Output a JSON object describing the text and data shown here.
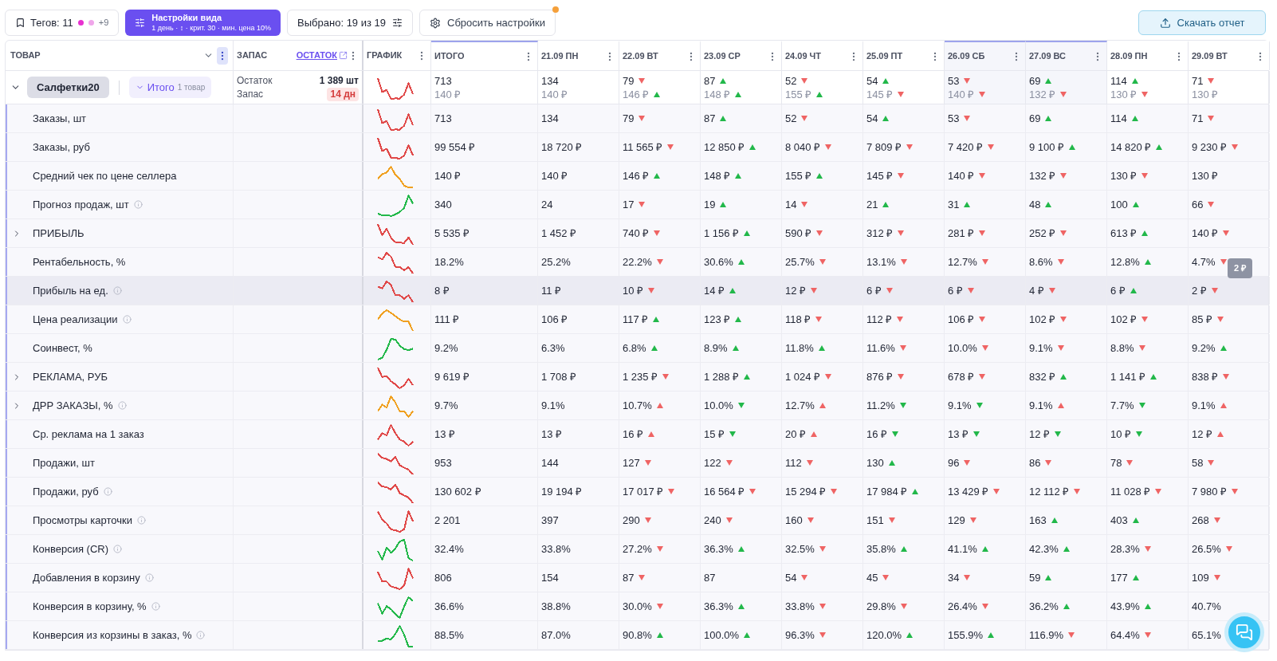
{
  "toolbar": {
    "tags": {
      "label": "Тегов: 11",
      "dots": [
        {
          "color": "#e830d0"
        },
        {
          "color": "#f0a6ea"
        }
      ],
      "more": "+9"
    },
    "view_settings": {
      "title": "Настройки вида",
      "subtitle": "1 день · ↕ · крит. 30 · мин. цена 10%"
    },
    "selected": "Выбрано: 19 из 19",
    "reset": {
      "label": "Сбросить настройки",
      "notification": true
    },
    "download": "Скачать отчет"
  },
  "header": {
    "product": "ТОВАР",
    "stock": "ЗАПАС",
    "stock_link": "ОСТАТОК",
    "chart": "ГРАФИК"
  },
  "columns": [
    {
      "label": "ИТОГО",
      "highlighted": true
    },
    {
      "label": "21.09 ПН",
      "highlighted": false
    },
    {
      "label": "22.09 ВТ",
      "highlighted": false
    },
    {
      "label": "23.09 СР",
      "highlighted": false
    },
    {
      "label": "24.09 ЧТ",
      "highlighted": false
    },
    {
      "label": "25.09 ПТ",
      "highlighted": false
    },
    {
      "label": "26.09 СБ",
      "highlighted": true
    },
    {
      "label": "27.09 ВС",
      "highlighted": true
    },
    {
      "label": "28.09 ПН",
      "highlighted": false
    },
    {
      "label": "29.09 ВТ",
      "highlighted": false
    }
  ],
  "product": {
    "name": "Салфетки20",
    "expanded": true,
    "total_label": "Итого",
    "total_count": "1 товар",
    "stock_label": "Остаток",
    "stock_value": "1 389 шт",
    "reserve_label": "Запас",
    "reserve_value": "14 дн",
    "color": "#e04848",
    "cells": [
      {
        "v": "713",
        "p": "140 ₽"
      },
      {
        "v": "134",
        "p": "140 ₽"
      },
      {
        "v": "79",
        "up": false,
        "p": "146 ₽",
        "p_up": true
      },
      {
        "v": "87",
        "up": true,
        "p": "148 ₽",
        "p_up": true
      },
      {
        "v": "52",
        "up": false,
        "p": "155 ₽",
        "p_up": true
      },
      {
        "v": "54",
        "up": true,
        "p": "145 ₽",
        "p_up": false
      },
      {
        "v": "53",
        "up": false,
        "p": "140 ₽",
        "p_up": false
      },
      {
        "v": "69",
        "up": true,
        "p": "132 ₽",
        "p_up": false
      },
      {
        "v": "114",
        "up": true,
        "p": "130 ₽",
        "p_up": false
      },
      {
        "v": "71",
        "up": false,
        "p": "130 ₽"
      }
    ]
  },
  "rows": [
    {
      "label": "Заказы, шт",
      "color": "#e04848",
      "cells": [
        {
          "v": "713"
        },
        {
          "v": "134"
        },
        {
          "v": "79",
          "up": false
        },
        {
          "v": "87",
          "up": true
        },
        {
          "v": "52",
          "up": false
        },
        {
          "v": "54",
          "up": true
        },
        {
          "v": "53",
          "up": false
        },
        {
          "v": "69",
          "up": true
        },
        {
          "v": "114",
          "up": true
        },
        {
          "v": "71",
          "up": false
        }
      ]
    },
    {
      "label": "Заказы, руб",
      "color": "#e04848",
      "cells": [
        {
          "v": "99 554 ₽"
        },
        {
          "v": "18 720 ₽"
        },
        {
          "v": "11 565 ₽",
          "up": false
        },
        {
          "v": "12 850 ₽",
          "up": true
        },
        {
          "v": "8 040 ₽",
          "up": false
        },
        {
          "v": "7 809 ₽",
          "up": false
        },
        {
          "v": "7 420 ₽",
          "up": false
        },
        {
          "v": "9 100 ₽",
          "up": true
        },
        {
          "v": "14 820 ₽",
          "up": true
        },
        {
          "v": "9 230 ₽",
          "up": false
        }
      ]
    },
    {
      "label": "Средний чек по цене селлера",
      "color": "#f0a020",
      "cells": [
        {
          "v": "140 ₽"
        },
        {
          "v": "140 ₽"
        },
        {
          "v": "146 ₽",
          "up": true
        },
        {
          "v": "148 ₽",
          "up": true
        },
        {
          "v": "155 ₽",
          "up": true
        },
        {
          "v": "145 ₽",
          "up": false
        },
        {
          "v": "140 ₽",
          "up": false
        },
        {
          "v": "132 ₽",
          "up": false
        },
        {
          "v": "130 ₽",
          "up": false
        },
        {
          "v": "130 ₽"
        }
      ]
    },
    {
      "label": "Прогноз продаж, шт",
      "info": true,
      "color": "#22b84a",
      "cells": [
        {
          "v": "340"
        },
        {
          "v": "24"
        },
        {
          "v": "17",
          "up": false
        },
        {
          "v": "19",
          "up": true
        },
        {
          "v": "14",
          "up": false
        },
        {
          "v": "21",
          "up": true
        },
        {
          "v": "31",
          "up": true
        },
        {
          "v": "48",
          "up": true
        },
        {
          "v": "100",
          "up": true
        },
        {
          "v": "66",
          "up": false
        }
      ]
    },
    {
      "label": "ПРИБЫЛЬ",
      "expandable": true,
      "color": "#e04848",
      "cells": [
        {
          "v": "5 535 ₽"
        },
        {
          "v": "1 452 ₽"
        },
        {
          "v": "740 ₽",
          "up": false
        },
        {
          "v": "1 156 ₽",
          "up": true
        },
        {
          "v": "590 ₽",
          "up": false
        },
        {
          "v": "312 ₽",
          "up": false
        },
        {
          "v": "281 ₽",
          "up": false
        },
        {
          "v": "252 ₽",
          "up": false
        },
        {
          "v": "613 ₽",
          "up": true
        },
        {
          "v": "140 ₽",
          "up": false
        }
      ]
    },
    {
      "label": "Рентабельность, %",
      "color": "#e04848",
      "cells": [
        {
          "v": "18.2%"
        },
        {
          "v": "25.2%"
        },
        {
          "v": "22.2%",
          "up": false
        },
        {
          "v": "30.6%",
          "up": true
        },
        {
          "v": "25.7%",
          "up": false
        },
        {
          "v": "13.1%",
          "up": false
        },
        {
          "v": "12.7%",
          "up": false
        },
        {
          "v": "8.6%",
          "up": false
        },
        {
          "v": "12.8%",
          "up": true
        },
        {
          "v": "4.7%",
          "up": false
        }
      ]
    },
    {
      "label": "Прибыль на ед.",
      "info": true,
      "hovered": true,
      "tooltip": "2 ₽",
      "color": "#e04848",
      "cells": [
        {
          "v": "8 ₽"
        },
        {
          "v": "11 ₽"
        },
        {
          "v": "10 ₽",
          "up": false
        },
        {
          "v": "14 ₽",
          "up": true
        },
        {
          "v": "12 ₽",
          "up": false
        },
        {
          "v": "6 ₽",
          "up": false
        },
        {
          "v": "6 ₽",
          "up": false
        },
        {
          "v": "4 ₽",
          "up": false
        },
        {
          "v": "6 ₽",
          "up": true
        },
        {
          "v": "2 ₽",
          "up": false
        }
      ]
    },
    {
      "label": "Цена реализации",
      "info": true,
      "color": "#f0a020",
      "cells": [
        {
          "v": "111 ₽"
        },
        {
          "v": "106 ₽"
        },
        {
          "v": "117 ₽",
          "up": true
        },
        {
          "v": "123 ₽",
          "up": true
        },
        {
          "v": "118 ₽",
          "up": false
        },
        {
          "v": "112 ₽",
          "up": false
        },
        {
          "v": "106 ₽",
          "up": false
        },
        {
          "v": "102 ₽",
          "up": false
        },
        {
          "v": "102 ₽",
          "up": false
        },
        {
          "v": "85 ₽",
          "up": false
        }
      ]
    },
    {
      "label": "Соинвест, %",
      "color": "#22b84a",
      "cells": [
        {
          "v": "9.2%"
        },
        {
          "v": "6.3%"
        },
        {
          "v": "6.8%",
          "up": true
        },
        {
          "v": "8.9%",
          "up": true
        },
        {
          "v": "11.8%",
          "up": true
        },
        {
          "v": "11.6%",
          "up": false
        },
        {
          "v": "10.0%",
          "up": false
        },
        {
          "v": "9.1%",
          "up": false
        },
        {
          "v": "8.8%",
          "up": false
        },
        {
          "v": "9.2%",
          "up": true
        }
      ]
    },
    {
      "label": "РЕКЛАМА, РУБ",
      "expandable": true,
      "color": "#e04848",
      "cells": [
        {
          "v": "9 619 ₽"
        },
        {
          "v": "1 708 ₽"
        },
        {
          "v": "1 235 ₽",
          "up": false
        },
        {
          "v": "1 288 ₽",
          "up": true
        },
        {
          "v": "1 024 ₽",
          "up": false
        },
        {
          "v": "876 ₽",
          "up": false
        },
        {
          "v": "678 ₽",
          "up": false
        },
        {
          "v": "832 ₽",
          "up": true
        },
        {
          "v": "1 141 ₽",
          "up": true
        },
        {
          "v": "838 ₽",
          "up": false
        }
      ]
    },
    {
      "label": "ДРР ЗАКАЗЫ, %",
      "expandable": true,
      "info": true,
      "inverse": true,
      "color": "#f0a020",
      "cells": [
        {
          "v": "9.7%"
        },
        {
          "v": "9.1%"
        },
        {
          "v": "10.7%",
          "up": true
        },
        {
          "v": "10.0%",
          "up": false
        },
        {
          "v": "12.7%",
          "up": true
        },
        {
          "v": "11.2%",
          "up": false
        },
        {
          "v": "9.1%",
          "up": false
        },
        {
          "v": "9.1%",
          "up": true
        },
        {
          "v": "7.7%",
          "up": false
        },
        {
          "v": "9.1%",
          "up": true
        }
      ]
    },
    {
      "label": "Ср. реклама на 1 заказ",
      "inverse": true,
      "color": "#e04848",
      "cells": [
        {
          "v": "13 ₽"
        },
        {
          "v": "13 ₽"
        },
        {
          "v": "16 ₽",
          "up": true
        },
        {
          "v": "15 ₽",
          "up": false
        },
        {
          "v": "20 ₽",
          "up": true
        },
        {
          "v": "16 ₽",
          "up": false
        },
        {
          "v": "13 ₽",
          "up": false
        },
        {
          "v": "12 ₽",
          "up": false
        },
        {
          "v": "10 ₽",
          "up": false
        },
        {
          "v": "12 ₽",
          "up": true
        }
      ]
    },
    {
      "label": "Продажи, шт",
      "color": "#e04848",
      "cells": [
        {
          "v": "953"
        },
        {
          "v": "144"
        },
        {
          "v": "127",
          "up": false
        },
        {
          "v": "122",
          "up": false
        },
        {
          "v": "112",
          "up": false
        },
        {
          "v": "130",
          "up": true
        },
        {
          "v": "96",
          "up": false
        },
        {
          "v": "86",
          "up": false
        },
        {
          "v": "78",
          "up": false
        },
        {
          "v": "58",
          "up": false
        }
      ]
    },
    {
      "label": "Продажи, руб",
      "info": true,
      "color": "#e04848",
      "cells": [
        {
          "v": "130 602 ₽"
        },
        {
          "v": "19 194 ₽"
        },
        {
          "v": "17 017 ₽",
          "up": false
        },
        {
          "v": "16 564 ₽",
          "up": false
        },
        {
          "v": "15 294 ₽",
          "up": false
        },
        {
          "v": "17 984 ₽",
          "up": true
        },
        {
          "v": "13 429 ₽",
          "up": false
        },
        {
          "v": "12 112 ₽",
          "up": false
        },
        {
          "v": "11 028 ₽",
          "up": false
        },
        {
          "v": "7 980 ₽",
          "up": false
        }
      ]
    },
    {
      "label": "Просмотры карточки",
      "info": true,
      "color": "#e04848",
      "cells": [
        {
          "v": "2 201"
        },
        {
          "v": "397"
        },
        {
          "v": "290",
          "up": false
        },
        {
          "v": "240",
          "up": false
        },
        {
          "v": "160",
          "up": false
        },
        {
          "v": "151",
          "up": false
        },
        {
          "v": "129",
          "up": false
        },
        {
          "v": "163",
          "up": true
        },
        {
          "v": "403",
          "up": true
        },
        {
          "v": "268",
          "up": false
        }
      ]
    },
    {
      "label": "Конверсия (CR)",
      "info": true,
      "color": "#22b84a",
      "cells": [
        {
          "v": "32.4%"
        },
        {
          "v": "33.8%"
        },
        {
          "v": "27.2%",
          "up": false
        },
        {
          "v": "36.3%",
          "up": true
        },
        {
          "v": "32.5%",
          "up": false
        },
        {
          "v": "35.8%",
          "up": true
        },
        {
          "v": "41.1%",
          "up": true
        },
        {
          "v": "42.3%",
          "up": true
        },
        {
          "v": "28.3%",
          "up": false
        },
        {
          "v": "26.5%",
          "up": false
        }
      ]
    },
    {
      "label": "Добавления в корзину",
      "info": true,
      "color": "#e04848",
      "cells": [
        {
          "v": "806"
        },
        {
          "v": "154"
        },
        {
          "v": "87",
          "up": false
        },
        {
          "v": "87"
        },
        {
          "v": "54",
          "up": false
        },
        {
          "v": "45",
          "up": false
        },
        {
          "v": "34",
          "up": false
        },
        {
          "v": "59",
          "up": true
        },
        {
          "v": "177",
          "up": true
        },
        {
          "v": "109",
          "up": false
        }
      ]
    },
    {
      "label": "Конверсия в корзину, %",
      "info": true,
      "color": "#22b84a",
      "cells": [
        {
          "v": "36.6%"
        },
        {
          "v": "38.8%"
        },
        {
          "v": "30.0%",
          "up": false
        },
        {
          "v": "36.3%",
          "up": true
        },
        {
          "v": "33.8%",
          "up": false
        },
        {
          "v": "29.8%",
          "up": false
        },
        {
          "v": "26.4%",
          "up": false
        },
        {
          "v": "36.2%",
          "up": true
        },
        {
          "v": "43.9%",
          "up": true
        },
        {
          "v": "40.7%"
        }
      ]
    },
    {
      "label": "Конверсия из корзины в заказ, %",
      "info": true,
      "color": "#22b84a",
      "cells": [
        {
          "v": "88.5%"
        },
        {
          "v": "87.0%"
        },
        {
          "v": "90.8%",
          "up": true
        },
        {
          "v": "100.0%",
          "up": true
        },
        {
          "v": "96.3%",
          "up": false
        },
        {
          "v": "120.0%",
          "up": true
        },
        {
          "v": "155.9%",
          "up": true
        },
        {
          "v": "116.9%",
          "up": false
        },
        {
          "v": "64.4%",
          "up": false
        },
        {
          "v": "65.1%"
        }
      ]
    }
  ]
}
